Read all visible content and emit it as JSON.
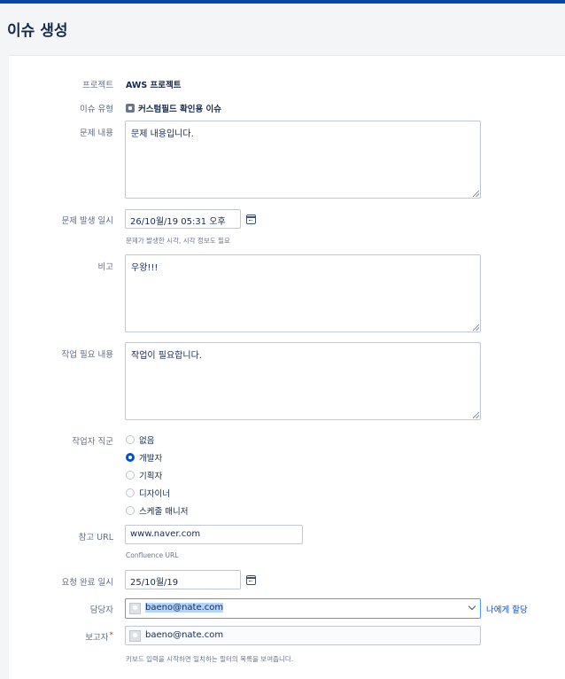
{
  "page": {
    "title": "이슈 생성"
  },
  "form": {
    "project": {
      "label": "프로젝트",
      "value": "AWS 프로젝트"
    },
    "issue_type": {
      "label": "이슈 유형",
      "value": "커스텀필드 확인용 이슈",
      "icon": "issue-type-icon"
    },
    "problem_content": {
      "label": "문제 내용",
      "value": "문제 내용입니다."
    },
    "problem_datetime": {
      "label": "문제 발생 일시",
      "value": "26/10월/19 05:31 오후",
      "help": "문제가 발생한 시각, 시각 정보도 필요",
      "icon": "calendar-icon"
    },
    "remarks": {
      "label": "비고",
      "value": "우왕!!!"
    },
    "work_needed": {
      "label": "작업 필요 내용",
      "value": "작업이 필요합니다."
    },
    "worker_role": {
      "label": "작업자 직군",
      "selected": "개발자",
      "options": [
        "없음",
        "개발자",
        "기획자",
        "디자이너",
        "스케줄 매니저"
      ]
    },
    "reference_url": {
      "label": "참고 URL",
      "value": "www.naver.com",
      "help": "Confluence URL"
    },
    "request_due": {
      "label": "요청 완료 일시",
      "value": "25/10월/19",
      "icon": "calendar-icon"
    },
    "assignee": {
      "label": "담당자",
      "value": "baeno@nate.com",
      "assign_to_me": "나에게 할당"
    },
    "reporter": {
      "label": "보고자",
      "required_mark": "*",
      "value": "baeno@nate.com",
      "help": "키보드 입력을 시작하면 일치하는 필터의 목록을 보여줍니다."
    }
  },
  "colors": {
    "brand": "#0747a6",
    "link": "#0052cc",
    "focus": "#4c9aff",
    "required": "#de350b"
  }
}
